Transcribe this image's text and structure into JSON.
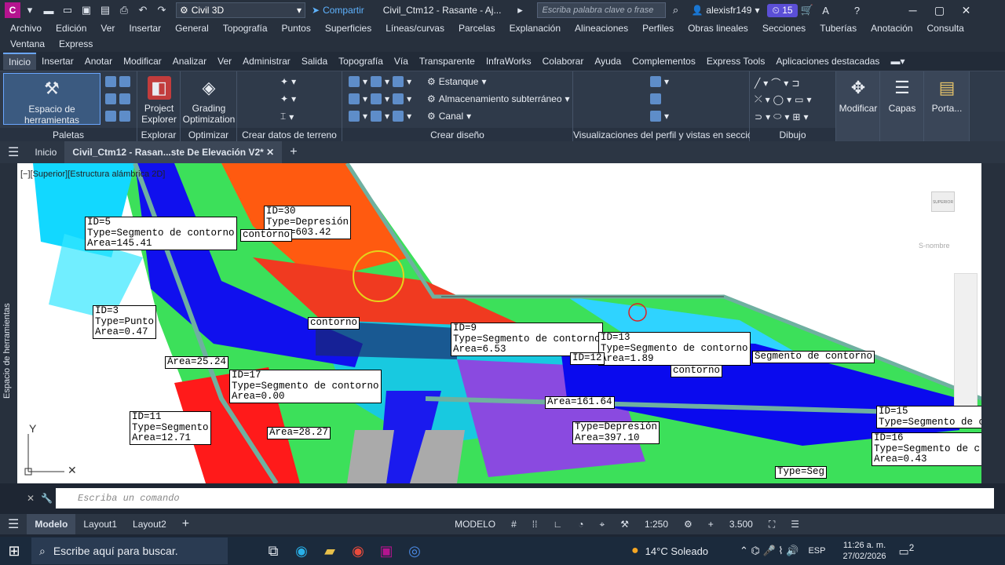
{
  "titlebar": {
    "app_letter": "C",
    "workspace": "Civil 3D",
    "share_label": "Compartir",
    "doc_title": "Civil_Ctm12 - Rasante - Aj...",
    "search_placeholder": "Escriba palabra clave o frase",
    "user": "alexisfr149",
    "badge": "15"
  },
  "menubar": {
    "row1": [
      "Archivo",
      "Edición",
      "Ver",
      "Insertar",
      "General",
      "Topografía",
      "Puntos",
      "Superficies",
      "Líneas/curvas",
      "Parcelas",
      "Explanación",
      "Alineaciones",
      "Perfiles",
      "Obras lineales",
      "Secciones",
      "Tuberías",
      "Anotación",
      "Consulta"
    ],
    "row2": [
      "Ventana",
      "Express"
    ]
  },
  "ribbon_tabs": [
    "Inicio",
    "Insertar",
    "Anotar",
    "Modificar",
    "Analizar",
    "Ver",
    "Administrar",
    "Salida",
    "Topografía",
    "Vía",
    "Transparente",
    "InfraWorks",
    "Colaborar",
    "Ayuda",
    "Complementos",
    "Express Tools",
    "Aplicaciones destacadas"
  ],
  "ribbon": {
    "tool_space": "Espacio de herramientas",
    "project_explorer": "Project Explorer",
    "grading": "Grading Optimization",
    "pond": "Estanque",
    "storage": "Almacenamiento subterráneo",
    "channel": "Canal",
    "modify": "Modificar",
    "layers": "Capas",
    "clipboard": "Porta...",
    "panels": {
      "palettes": "Paletas",
      "explorer": "Explorar",
      "optimizer": "Optimizar",
      "terrain": "Crear datos de terreno",
      "design": "Crear diseño",
      "profile": "Visualizaciones del perfil y vistas en sección",
      "draw": "Dibujo"
    }
  },
  "doctabs": {
    "home": "Inicio",
    "file": "Civil_Ctm12 - Rasan...ste De Elevación V2*"
  },
  "viewport": {
    "label": "[−][Superior][Estructura alámbrica 2D]",
    "side_label": "Espacio de herramientas",
    "viewcube": "SUPERIOR",
    "ucs": "S-nombre",
    "labels": [
      {
        "text": "ID=30\nType=Depresión\nArea=603.42"
      },
      {
        "text": "ID=5\nType=Segmento de contorno\nArea=145.41"
      },
      {
        "text": "ID=3\nType=Punto\nArea=0.47"
      },
      {
        "text": "ID=9\nType=Segmento de contorno\nArea=6.53"
      },
      {
        "text": "ID=13\nType=Segmento de contorno\nArea=1.89"
      },
      {
        "text": "ID=17\nType=Segmento de contorno\nArea=0.00"
      },
      {
        "text": "ID=11\nType=Segmento\nArea=12.71"
      },
      {
        "text": "ID=15\nType=Segmento de c"
      },
      {
        "text": "ID=16\nType=Segmento de c\nArea=0.43"
      },
      {
        "text": "Type=Depresión\nArea=397.10"
      },
      {
        "text": "Area=161.64"
      },
      {
        "text": "Area=25.24"
      },
      {
        "text": "Area=28.27"
      },
      {
        "text": "ID=12"
      },
      {
        "text": "Segmento de contorno"
      },
      {
        "text": "contorno"
      },
      {
        "text": "contorno"
      },
      {
        "text": "contorno"
      },
      {
        "text": "Type=Seg"
      }
    ]
  },
  "cmdline": {
    "placeholder": "Escriba un comando"
  },
  "statusbar": {
    "tabs": [
      "Modelo",
      "Layout1",
      "Layout2"
    ],
    "mode": "MODELO",
    "scale": "1:250",
    "value": "3.500"
  },
  "taskbar": {
    "search": "Escribe aquí para buscar.",
    "weather": "14°C  Soleado",
    "lang": "ESP",
    "time": "11:26 a. m.",
    "date": "27/02/2026",
    "notifications": "2"
  }
}
